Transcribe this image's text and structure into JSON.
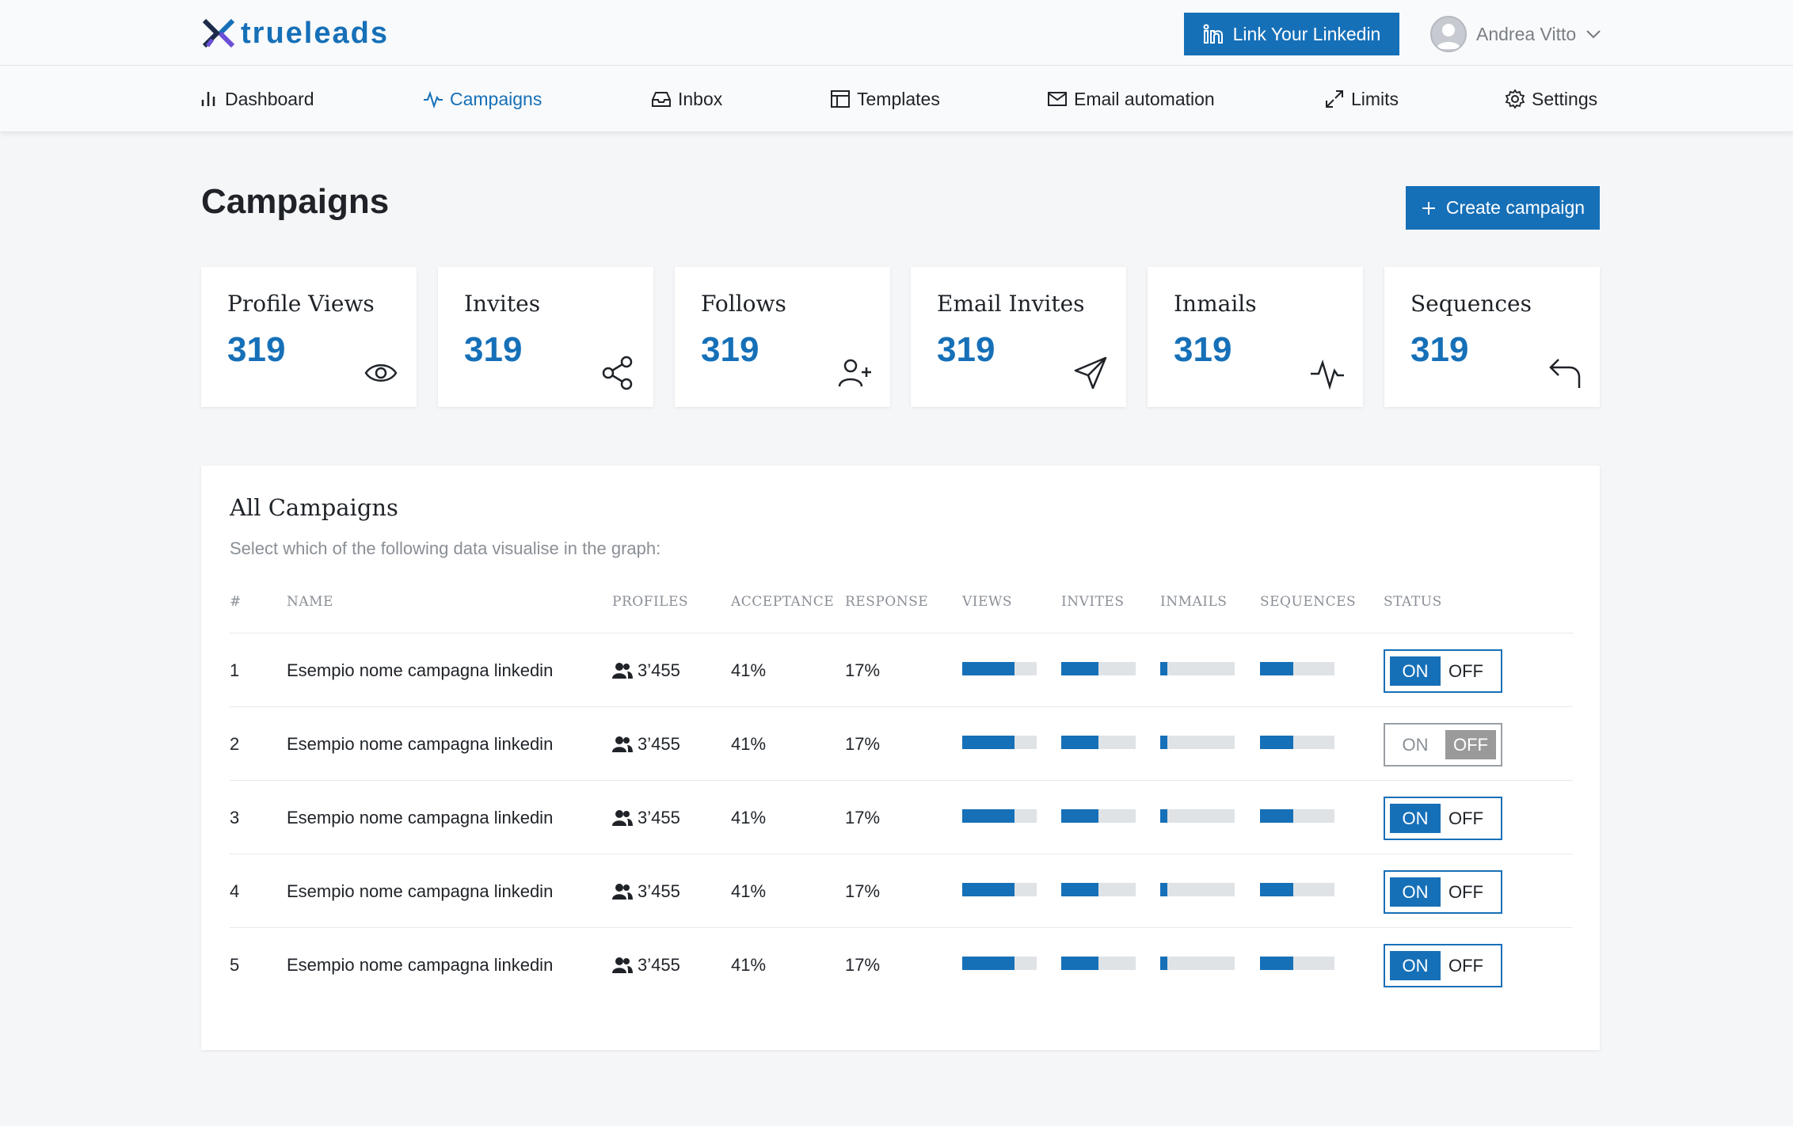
{
  "brand": {
    "name": "trueleads"
  },
  "header": {
    "link_button": "Link Your Linkedin",
    "user_name": "Andrea Vitto"
  },
  "nav": {
    "items": [
      {
        "label": "Dashboard",
        "icon": "bar-chart-icon"
      },
      {
        "label": "Campaigns",
        "icon": "activity-icon",
        "active": true
      },
      {
        "label": "Inbox",
        "icon": "inbox-icon"
      },
      {
        "label": "Templates",
        "icon": "layout-icon"
      },
      {
        "label": "Email automation",
        "icon": "mail-icon"
      },
      {
        "label": "Limits",
        "icon": "expand-icon"
      },
      {
        "label": "Settings",
        "icon": "gear-icon"
      }
    ]
  },
  "page": {
    "title": "Campaigns",
    "create_button": "Create campaign"
  },
  "stats": [
    {
      "label": "Profile Views",
      "value": "319",
      "icon": "eye-icon"
    },
    {
      "label": "Invites",
      "value": "319",
      "icon": "share-icon"
    },
    {
      "label": "Follows",
      "value": "319",
      "icon": "user-plus-icon"
    },
    {
      "label": "Email Invites",
      "value": "319",
      "icon": "send-icon"
    },
    {
      "label": "Inmails",
      "value": "319",
      "icon": "activity-icon"
    },
    {
      "label": "Sequences",
      "value": "319",
      "icon": "corner-up-left-icon"
    }
  ],
  "campaigns": {
    "title": "All Campaigns",
    "subtitle": "Select which of the following data visualise in the graph:",
    "columns": [
      "#",
      "NAME",
      "PROFILES",
      "ACCEPTANCE",
      "RESPONSE",
      "VIEWS",
      "INVITES",
      "INMAILS",
      "SEQUENCES",
      "STATUS"
    ],
    "toggle_labels": {
      "on": "ON",
      "off": "OFF"
    },
    "rows": [
      {
        "num": "1",
        "name": "Esempio nome campagna linkedin",
        "profiles": "3’455",
        "acceptance": "41%",
        "response": "17%",
        "views": 0.7,
        "invites": 0.5,
        "inmails": 0.1,
        "sequences": 0.45,
        "status": "on"
      },
      {
        "num": "2",
        "name": "Esempio nome campagna linkedin",
        "profiles": "3’455",
        "acceptance": "41%",
        "response": "17%",
        "views": 0.7,
        "invites": 0.5,
        "inmails": 0.1,
        "sequences": 0.45,
        "status": "off"
      },
      {
        "num": "3",
        "name": "Esempio nome campagna linkedin",
        "profiles": "3’455",
        "acceptance": "41%",
        "response": "17%",
        "views": 0.7,
        "invites": 0.5,
        "inmails": 0.1,
        "sequences": 0.45,
        "status": "on"
      },
      {
        "num": "4",
        "name": "Esempio nome campagna linkedin",
        "profiles": "3’455",
        "acceptance": "41%",
        "response": "17%",
        "views": 0.7,
        "invites": 0.5,
        "inmails": 0.1,
        "sequences": 0.45,
        "status": "on"
      },
      {
        "num": "5",
        "name": "Esempio nome campagna linkedin",
        "profiles": "3’455",
        "acceptance": "41%",
        "response": "17%",
        "views": 0.7,
        "invites": 0.5,
        "inmails": 0.1,
        "sequences": 0.45,
        "status": "on"
      }
    ]
  },
  "colors": {
    "accent": "#1670b8",
    "bar_track": "#dfe3e6",
    "logo_dark": "#1c2b4a",
    "logo_purple": "#6b4fd6"
  }
}
